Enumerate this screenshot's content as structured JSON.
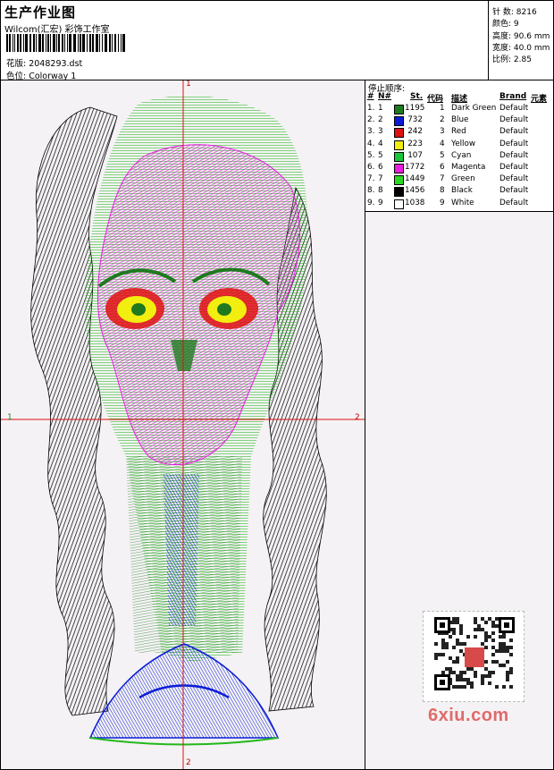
{
  "header": {
    "title": "生产作业图",
    "company": "Wilcom(汇宏) 彩饰工作室",
    "design_label": "花版: 2048293.dst",
    "colorway_label": "色位: Colorway 1"
  },
  "specs": [
    {
      "label": "针 数:",
      "value": "8216"
    },
    {
      "label": "颜色:",
      "value": "9"
    },
    {
      "label": "高度:",
      "value": "90.6 mm"
    },
    {
      "label": "宽度:",
      "value": "40.0 mm"
    },
    {
      "label": "比例:",
      "value": "2.85"
    }
  ],
  "axes": {
    "top": "1",
    "left": "1",
    "right": "2",
    "bottom": "2"
  },
  "stop_sequence": {
    "title": "停止顺序:",
    "headers": {
      "num": "#",
      "n": "N#",
      "st": "St.",
      "code": "代码",
      "desc": "描述",
      "brand": "Brand",
      "elem": "元素"
    },
    "rows": [
      {
        "num": "1.",
        "n": "1",
        "color": "#1f7a1f",
        "st": "1195",
        "code": "1",
        "desc": "Dark Green",
        "brand": "Default"
      },
      {
        "num": "2.",
        "n": "2",
        "color": "#0a1cd8",
        "st": "732",
        "code": "2",
        "desc": "Blue",
        "brand": "Default"
      },
      {
        "num": "3.",
        "n": "3",
        "color": "#e01010",
        "st": "242",
        "code": "3",
        "desc": "Red",
        "brand": "Default"
      },
      {
        "num": "4.",
        "n": "4",
        "color": "#f2ee10",
        "st": "223",
        "code": "4",
        "desc": "Yellow",
        "brand": "Default"
      },
      {
        "num": "5.",
        "n": "5",
        "color": "#18c83a",
        "st": "107",
        "code": "5",
        "desc": "Cyan",
        "brand": "Default"
      },
      {
        "num": "6.",
        "n": "6",
        "color": "#e81ee0",
        "st": "1772",
        "code": "6",
        "desc": "Magenta",
        "brand": "Default"
      },
      {
        "num": "7.",
        "n": "7",
        "color": "#2ad820",
        "st": "1449",
        "code": "7",
        "desc": "Green",
        "brand": "Default"
      },
      {
        "num": "8.",
        "n": "8",
        "color": "#000000",
        "st": "1456",
        "code": "8",
        "desc": "Black",
        "brand": "Default"
      },
      {
        "num": "9.",
        "n": "9",
        "color": "#ffffff",
        "st": "1038",
        "code": "9",
        "desc": "White",
        "brand": "Default"
      }
    ]
  },
  "watermark": "6xiu.com"
}
